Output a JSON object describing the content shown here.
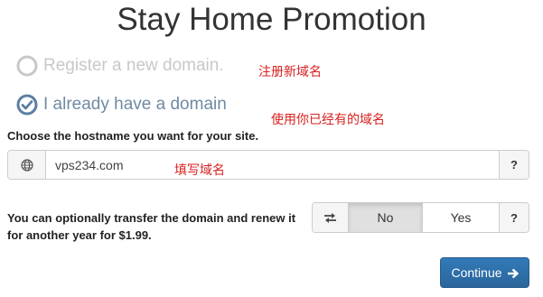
{
  "page": {
    "title": "Stay Home Promotion"
  },
  "domain_options": [
    {
      "label": "Register a new domain.",
      "selected": false,
      "icon": "radio-unchecked-icon"
    },
    {
      "label": "I already have a domain",
      "selected": true,
      "icon": "radio-checked-icon"
    }
  ],
  "annotations": {
    "register": "注册新域名",
    "existing": "使用你已经有的域名",
    "fill_in": "填写域名"
  },
  "hostname": {
    "label": "Choose the hostname you want for your site.",
    "value": "vps234.com",
    "globe_icon": "globe-icon",
    "help": "?"
  },
  "transfer": {
    "text": "You can optionally transfer the domain and renew it for another year for $1.99.",
    "icon": "transfer-arrows-icon",
    "options": [
      "No",
      "Yes"
    ],
    "selected": "No",
    "help": "?"
  },
  "continue_button": {
    "label": "Continue",
    "icon": "arrow-right-icon"
  },
  "colors": {
    "accent": "#337ab7",
    "annotation": "#d9201f",
    "selected_label": "#6f8aa3",
    "unselected_label": "#c8c8c8"
  }
}
